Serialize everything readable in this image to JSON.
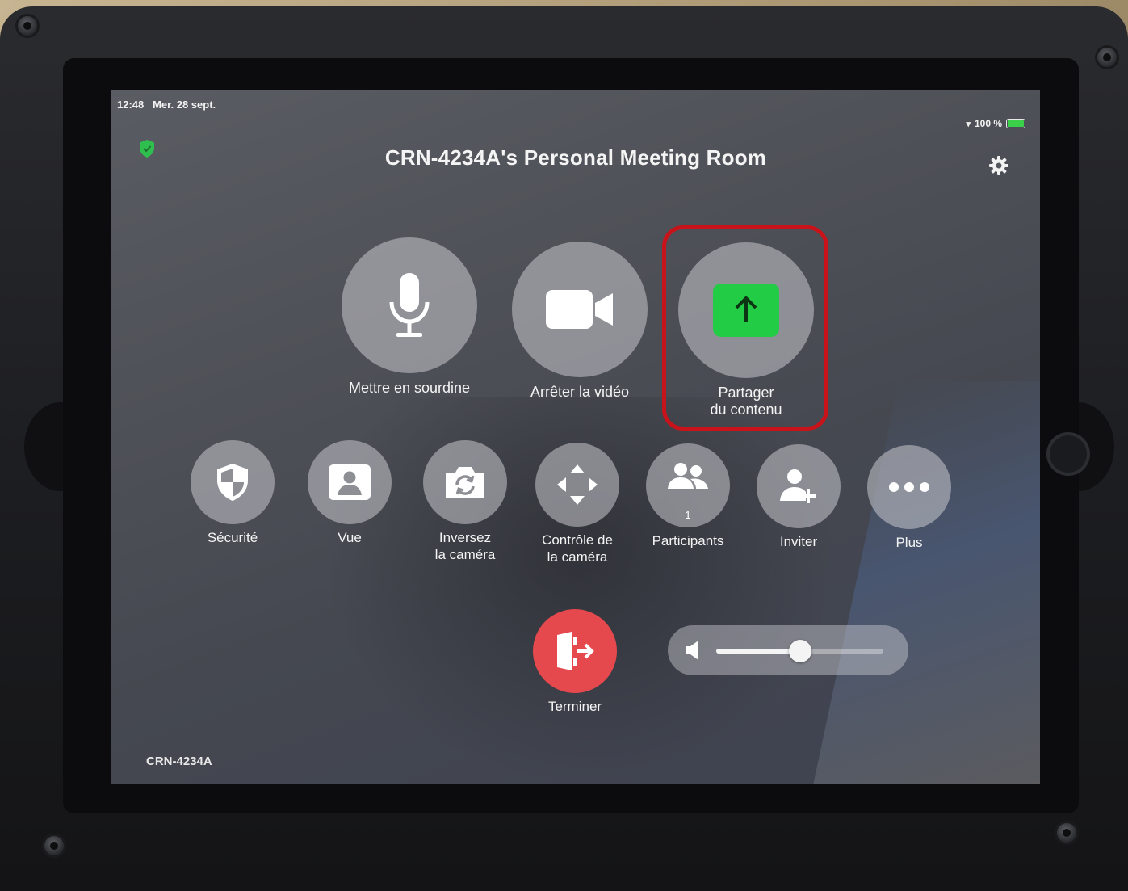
{
  "status_bar": {
    "time": "12:48",
    "date": "Mer. 28 sept.",
    "battery": "100 %"
  },
  "meeting": {
    "title": "CRN-4234A's Personal Meeting Room",
    "room_id": "CRN-4234A"
  },
  "main_controls": [
    {
      "label": "Mettre en sourdine",
      "icon": "microphone-icon"
    },
    {
      "label": "Arrêter la vidéo",
      "icon": "video-camera-icon"
    },
    {
      "label": "Partager\ndu contenu",
      "icon": "share-upload-icon"
    }
  ],
  "secondary_controls": [
    {
      "label": "Sécurité",
      "icon": "security-shield-icon"
    },
    {
      "label": "Vue",
      "icon": "view-person-icon"
    },
    {
      "label": "Inversez\nla caméra",
      "icon": "flip-camera-icon"
    },
    {
      "label": "Contrôle de\nla caméra",
      "icon": "camera-control-arrows-icon"
    },
    {
      "label": "Participants",
      "icon": "participants-icon",
      "count": "1"
    },
    {
      "label": "Inviter",
      "icon": "invite-person-icon"
    },
    {
      "label": "Plus",
      "icon": "more-dots-icon"
    }
  ],
  "end_button": {
    "label": "Terminer",
    "color": "#e5484d"
  },
  "volume": {
    "level": 0.5
  },
  "colors": {
    "share_accent": "#22cc44",
    "secure_badge": "#2fbf4f",
    "highlight": "#c8131a"
  }
}
